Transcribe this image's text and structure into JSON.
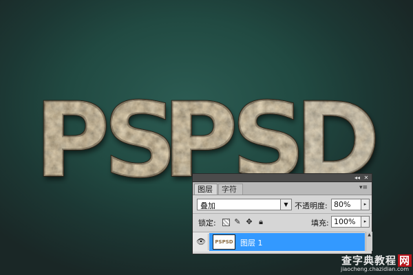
{
  "artwork": {
    "text": "PSPSD",
    "style": "rock-texture"
  },
  "layers_panel": {
    "topbar": {
      "collapse_icon": "double-chevron-icon",
      "close_label": "✕"
    },
    "tabs": [
      {
        "label": "图层",
        "active": true
      },
      {
        "label": "字符",
        "active": false
      }
    ],
    "menu_icon": "panel-menu-icon",
    "blend_mode": "叠加",
    "opacity_label": "不透明度:",
    "opacity_value": "80%",
    "lock_label": "锁定:",
    "fill_label": "填充:",
    "fill_value": "100%",
    "lock_icons": [
      "lock-transparency-icon",
      "lock-paint-icon",
      "lock-position-icon",
      "lock-all-icon"
    ],
    "layers": [
      {
        "name": "图层 1",
        "thumbnail_text": "PSPSD",
        "visible": true,
        "selected": true
      }
    ]
  },
  "watermark": {
    "main_a": "查字典",
    "main_b": "教程",
    "main_c": "网",
    "url": "jiaocheng.chazidian.com"
  },
  "colors": {
    "background": "#214a42",
    "selection": "#3399ff",
    "panel": "#d6d6d6"
  }
}
